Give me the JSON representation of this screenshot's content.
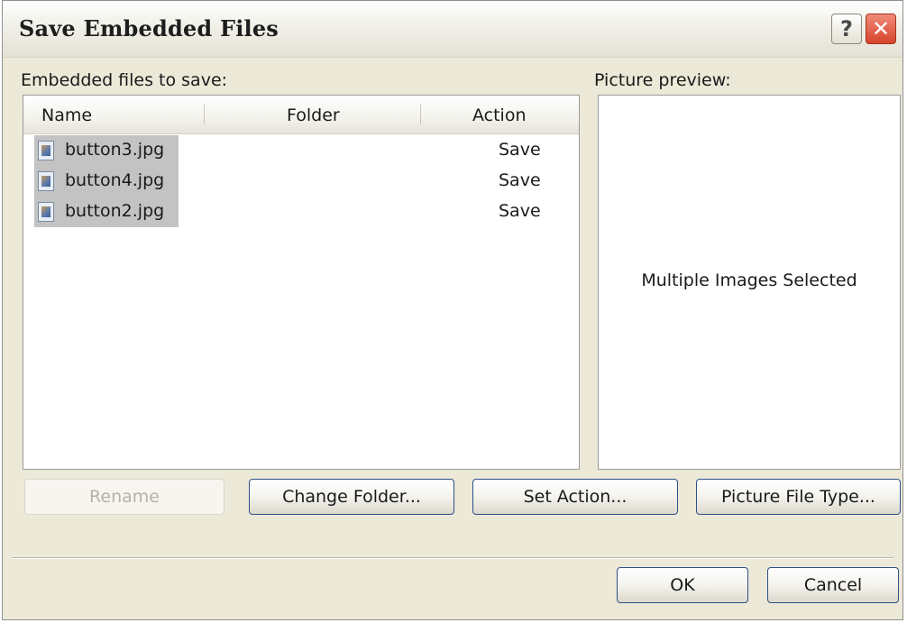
{
  "window": {
    "title": "Save Embedded Files",
    "help_glyph": "?",
    "close_glyph": "✕"
  },
  "files_section": {
    "label": "Embedded files to save:",
    "columns": [
      "Name",
      "Folder",
      "Action"
    ],
    "rows": [
      {
        "name": "button3.jpg",
        "folder": "",
        "action": "Save",
        "selected": true,
        "icon": "image-file-icon"
      },
      {
        "name": "button4.jpg",
        "folder": "",
        "action": "Save",
        "selected": true,
        "icon": "image-file-icon"
      },
      {
        "name": "button2.jpg",
        "folder": "",
        "action": "Save",
        "selected": true,
        "icon": "image-file-icon"
      }
    ]
  },
  "preview_section": {
    "label": "Picture preview:",
    "message": "Multiple Images Selected"
  },
  "buttons": {
    "rename": "Rename",
    "change_folder": "Change Folder...",
    "set_action": "Set Action...",
    "picture_file_type": "Picture File Type...",
    "ok": "OK",
    "cancel": "Cancel"
  },
  "colors": {
    "dialog_bg": "#ece9d8",
    "selection_bg": "#c3c3c3",
    "button_border": "#2e4f8a",
    "close_button": "#d6432a"
  }
}
